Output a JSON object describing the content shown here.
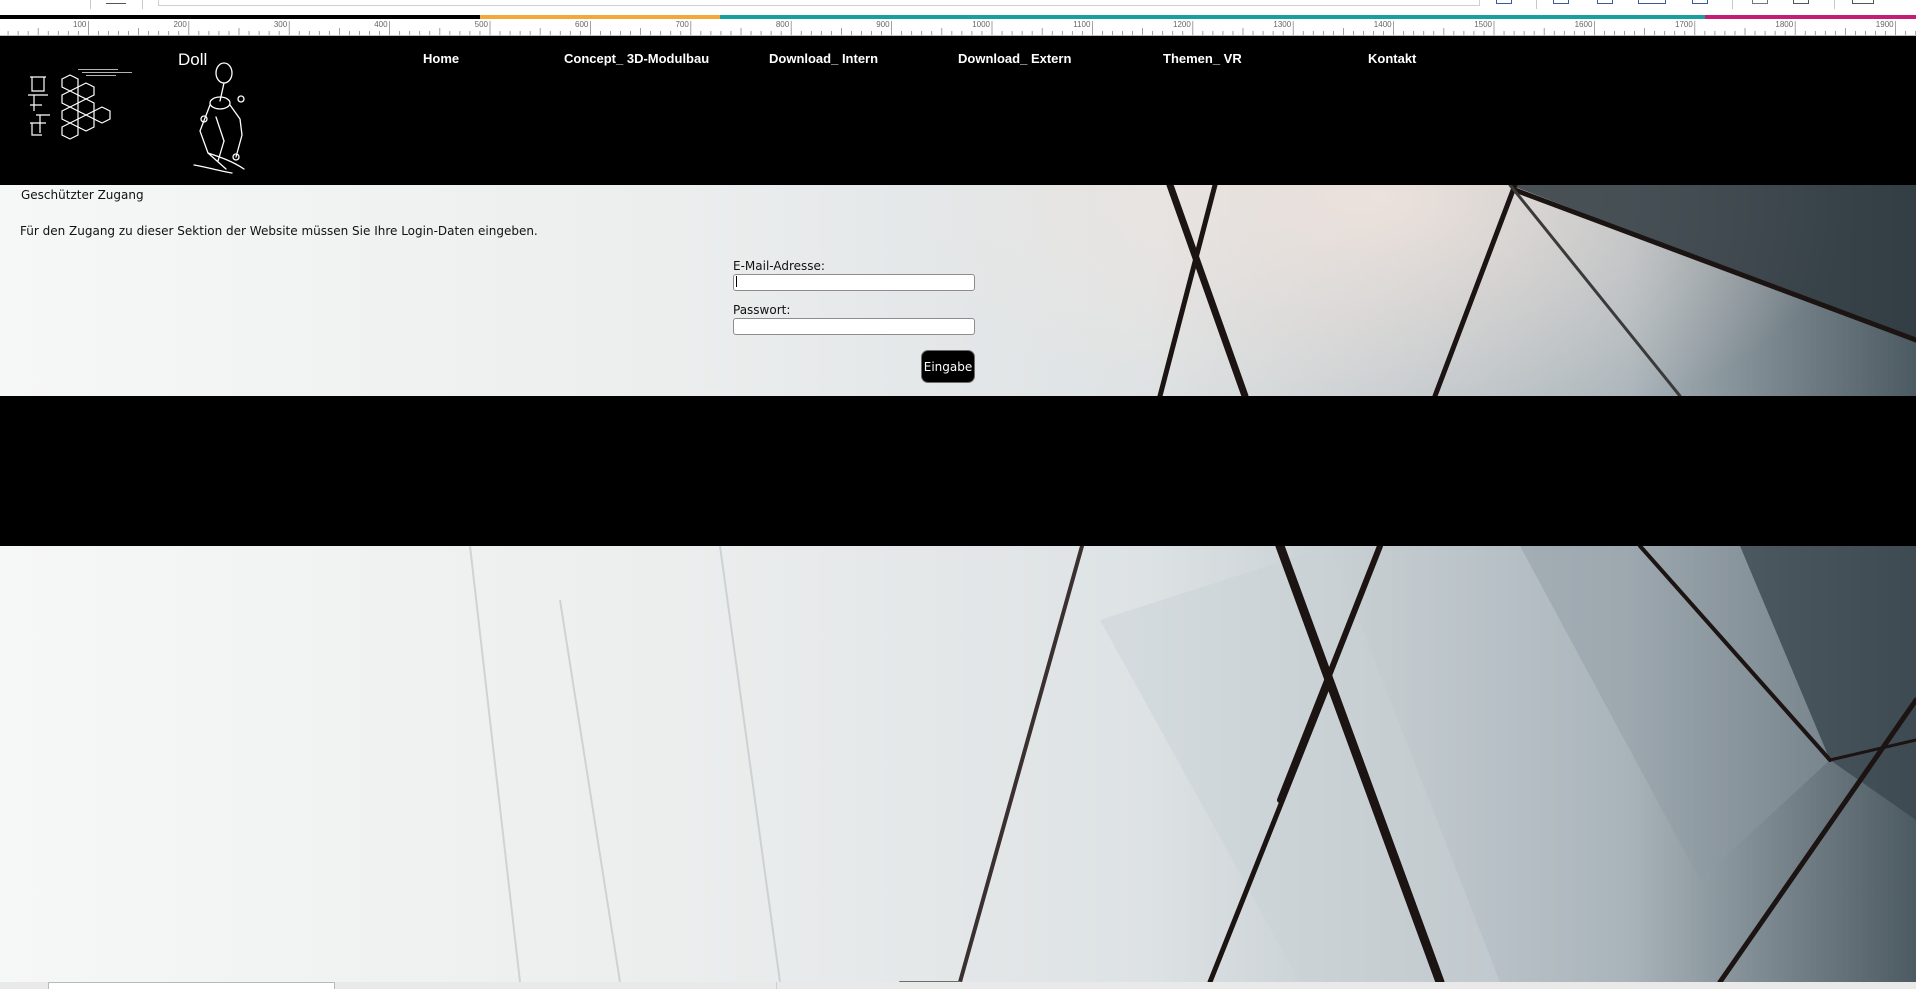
{
  "header": {
    "brand": "Doll",
    "nav": [
      {
        "label": "Home"
      },
      {
        "label": "Concept_ 3D-Modulbau"
      },
      {
        "label": "Download_ Intern"
      },
      {
        "label": "Download_ Extern"
      },
      {
        "label": "Themen_ VR"
      },
      {
        "label": "Kontakt"
      }
    ]
  },
  "login": {
    "title": "Geschützter Zugang",
    "description": "Für den Zugang zu dieser Sektion der Website müssen Sie Ihre Login-Daten eingeben.",
    "email_label": "E-Mail-Adresse:",
    "email_value": "",
    "password_label": "Passwort:",
    "password_value": "",
    "submit_label": "Eingabe"
  },
  "ruler": {
    "ticks": [
      "100",
      "200",
      "300",
      "400",
      "500",
      "600",
      "700",
      "800",
      "900",
      "1000",
      "1100",
      "1200",
      "1300",
      "1400",
      "1500",
      "1600",
      "1700",
      "1800",
      "1900"
    ]
  },
  "colors": {
    "header_bg": "#000000",
    "text_on_dark": "#ffffff",
    "button_bg": "#000000",
    "ruler_segment_1": "#000000",
    "ruler_segment_2": "#f2a83c",
    "ruler_segment_3": "#1a9e9e",
    "ruler_segment_4": "#c21e74"
  },
  "icons": {
    "logo_left": "hexagon-logo-icon",
    "logo_right": "doll-figure-icon"
  }
}
